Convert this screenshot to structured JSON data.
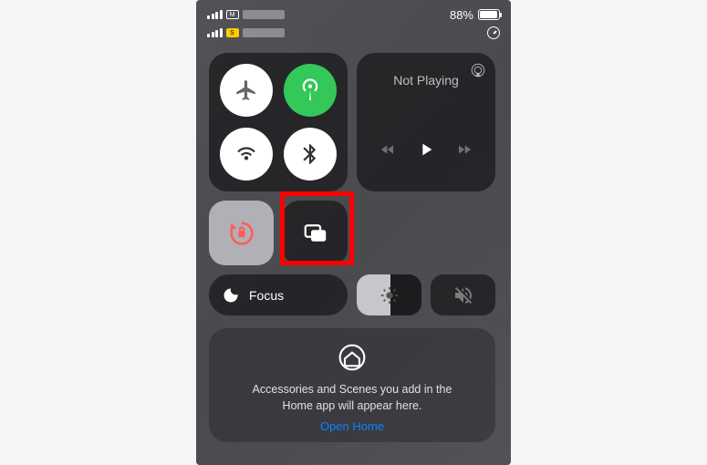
{
  "status": {
    "battery_percent": "88%",
    "sim1_label": "M",
    "sim2_label": "S"
  },
  "media": {
    "title": "Not Playing"
  },
  "focus": {
    "label": "Focus"
  },
  "home": {
    "message_line1": "Accessories and Scenes you add in the",
    "message_line2": "Home app will appear here.",
    "link": "Open Home"
  },
  "highlight": {
    "target": "screen-mirroring-button"
  },
  "colors": {
    "active_green": "#34c759",
    "highlight": "#ff0000",
    "lock_orange": "#ff5b5b",
    "link_blue": "#0a84ff"
  }
}
